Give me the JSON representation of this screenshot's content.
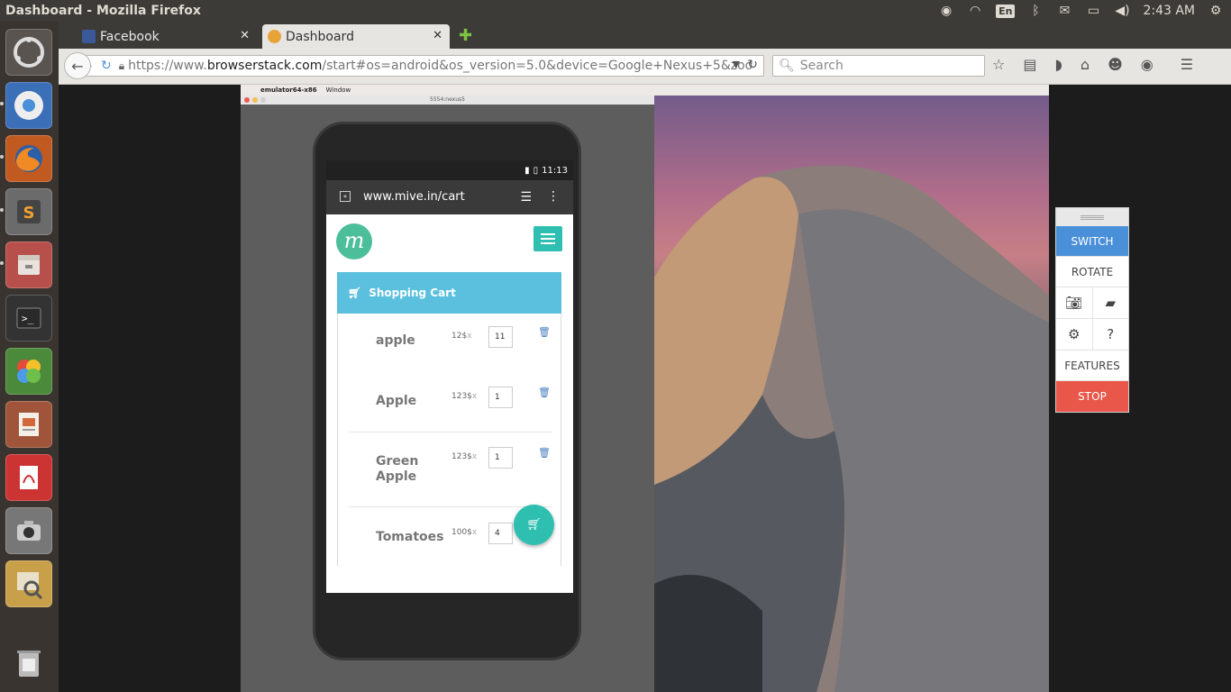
{
  "window": {
    "title": "Dashboard - Mozilla Firefox"
  },
  "tray": {
    "lang": "En",
    "clock": "2:43 AM"
  },
  "tabs": [
    {
      "label": "Facebook",
      "color": "#3b5998"
    },
    {
      "label": "Dashboard",
      "color": "#e8a23a"
    }
  ],
  "navbar": {
    "url_scheme": "https://www.",
    "url_host": "browserstack.com",
    "url_path": "/start#os=android&os_version=5.0&device=Google+Nexus+5&zoo",
    "search_placeholder": "Search"
  },
  "mac": {
    "app_name": "emulator64-x86",
    "menu_item": "Window",
    "emulator_title": "5554:nexus5"
  },
  "phone": {
    "time": "11:13",
    "url": "www.mive.in/cart",
    "cart_title": "Shopping Cart",
    "items": [
      {
        "name": "apple",
        "price": "12$",
        "qty": "11"
      },
      {
        "name": "Apple",
        "price": "123$",
        "qty": "1"
      },
      {
        "name": "Green Apple",
        "price": "123$",
        "qty": "1"
      },
      {
        "name": "Tomatoes",
        "price": "100$",
        "qty": "4"
      }
    ],
    "x_mark": "x"
  },
  "bs_panel": {
    "switch": "SWITCH",
    "rotate": "ROTATE",
    "features": "FEATURES",
    "stop": "STOP",
    "accent": "#4a90d9",
    "stop_color": "#e8574a"
  }
}
